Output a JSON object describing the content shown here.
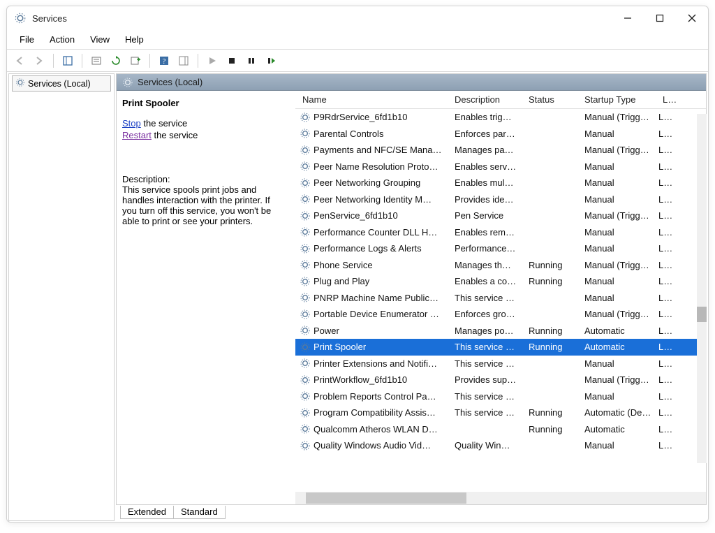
{
  "window": {
    "title": "Services"
  },
  "menu": [
    "File",
    "Action",
    "View",
    "Help"
  ],
  "tree": {
    "root": "Services (Local)"
  },
  "header_band": "Services (Local)",
  "columns": {
    "name": "Name",
    "description": "Description",
    "status": "Status",
    "startup": "Startup Type",
    "logon": "Log On As"
  },
  "selected_service": {
    "name": "Print Spooler",
    "actions": {
      "stop_label": "Stop",
      "stop_suffix": " the service",
      "restart_label": "Restart",
      "restart_suffix": " the service"
    },
    "desc_heading": "Description:",
    "desc_text": "This service spools print jobs and handles interaction with the printer. If you turn off this service, you won't be able to print or see your printers."
  },
  "services": [
    {
      "name": "P9RdrService_6fd1b10",
      "desc": "Enables trig…",
      "status": "",
      "startup": "Manual (Trigg…",
      "logon": "Lo…"
    },
    {
      "name": "Parental Controls",
      "desc": "Enforces par…",
      "status": "",
      "startup": "Manual",
      "logon": "Lo…"
    },
    {
      "name": "Payments and NFC/SE Mana…",
      "desc": "Manages pa…",
      "status": "",
      "startup": "Manual (Trigg…",
      "logon": "Lo…"
    },
    {
      "name": "Peer Name Resolution Proto…",
      "desc": "Enables serv…",
      "status": "",
      "startup": "Manual",
      "logon": "Lo…"
    },
    {
      "name": "Peer Networking Grouping",
      "desc": "Enables mul…",
      "status": "",
      "startup": "Manual",
      "logon": "Lo…"
    },
    {
      "name": "Peer Networking Identity M…",
      "desc": "Provides ide…",
      "status": "",
      "startup": "Manual",
      "logon": "Lo…"
    },
    {
      "name": "PenService_6fd1b10",
      "desc": "Pen Service",
      "status": "",
      "startup": "Manual (Trigg…",
      "logon": "Lo…"
    },
    {
      "name": "Performance Counter DLL H…",
      "desc": "Enables rem…",
      "status": "",
      "startup": "Manual",
      "logon": "Lo…"
    },
    {
      "name": "Performance Logs & Alerts",
      "desc": "Performance…",
      "status": "",
      "startup": "Manual",
      "logon": "Lo…"
    },
    {
      "name": "Phone Service",
      "desc": "Manages th…",
      "status": "Running",
      "startup": "Manual (Trigg…",
      "logon": "Lo…"
    },
    {
      "name": "Plug and Play",
      "desc": "Enables a co…",
      "status": "Running",
      "startup": "Manual",
      "logon": "Lo…"
    },
    {
      "name": "PNRP Machine Name Public…",
      "desc": "This service …",
      "status": "",
      "startup": "Manual",
      "logon": "Lo…"
    },
    {
      "name": "Portable Device Enumerator …",
      "desc": "Enforces gro…",
      "status": "",
      "startup": "Manual (Trigg…",
      "logon": "Lo…"
    },
    {
      "name": "Power",
      "desc": "Manages po…",
      "status": "Running",
      "startup": "Automatic",
      "logon": "Lo…"
    },
    {
      "name": "Print Spooler",
      "desc": "This service …",
      "status": "Running",
      "startup": "Automatic",
      "logon": "Lo…",
      "selected": true
    },
    {
      "name": "Printer Extensions and Notifi…",
      "desc": "This service …",
      "status": "",
      "startup": "Manual",
      "logon": "Lo…"
    },
    {
      "name": "PrintWorkflow_6fd1b10",
      "desc": "Provides sup…",
      "status": "",
      "startup": "Manual (Trigg…",
      "logon": "Lo…"
    },
    {
      "name": "Problem Reports Control Pa…",
      "desc": "This service …",
      "status": "",
      "startup": "Manual",
      "logon": "Lo…"
    },
    {
      "name": "Program Compatibility Assis…",
      "desc": "This service …",
      "status": "Running",
      "startup": "Automatic (De…",
      "logon": "Lo…"
    },
    {
      "name": "Qualcomm Atheros WLAN D…",
      "desc": "",
      "status": "Running",
      "startup": "Automatic",
      "logon": "Lo…"
    },
    {
      "name": "Quality Windows Audio Vid…",
      "desc": "Quality Win…",
      "status": "",
      "startup": "Manual",
      "logon": "Lo…"
    }
  ],
  "tabs": {
    "extended": "Extended",
    "standard": "Standard"
  }
}
